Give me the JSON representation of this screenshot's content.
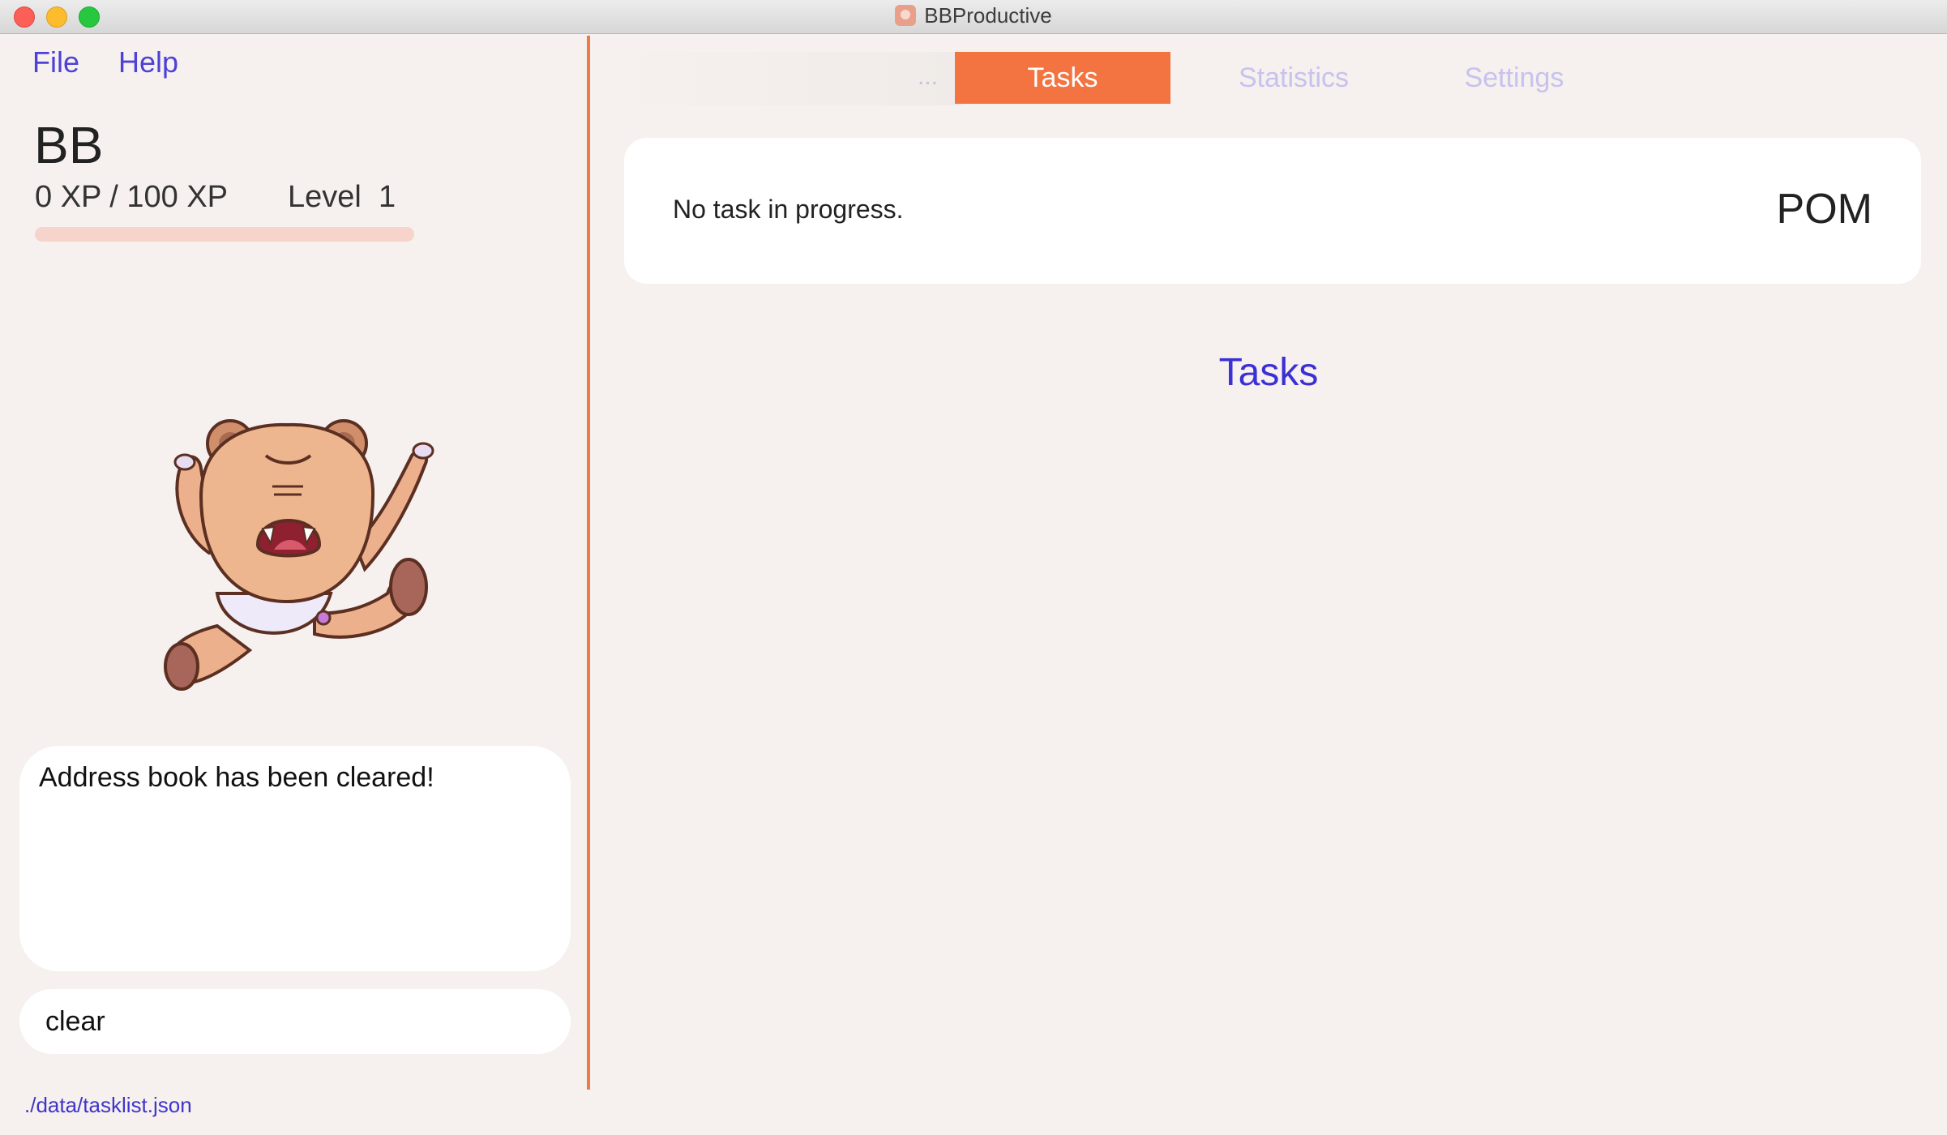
{
  "window": {
    "title": "BBProductive"
  },
  "menu": {
    "file": "File",
    "help": "Help"
  },
  "pet": {
    "name": "BB",
    "xp_text": "0 XP / 100 XP",
    "level_label": "Level",
    "level_value": "1",
    "xp_progress_fraction": 0
  },
  "result_display": {
    "text": "Address book has been cleared!"
  },
  "command_box": {
    "value": "clear"
  },
  "status_bar": {
    "path": "./data/tasklist.json"
  },
  "tabs": {
    "overflow": "...",
    "items": [
      {
        "label": "Tasks",
        "selected": true
      },
      {
        "label": "Statistics",
        "selected": false
      },
      {
        "label": "Settings",
        "selected": false
      }
    ]
  },
  "current_task": {
    "status_text": "No task in progress.",
    "pom_label": "POM"
  },
  "task_list": {
    "heading": "Tasks"
  },
  "colors": {
    "accent": "#f37341",
    "link": "#4d41d8",
    "background": "#f6f0ee"
  }
}
